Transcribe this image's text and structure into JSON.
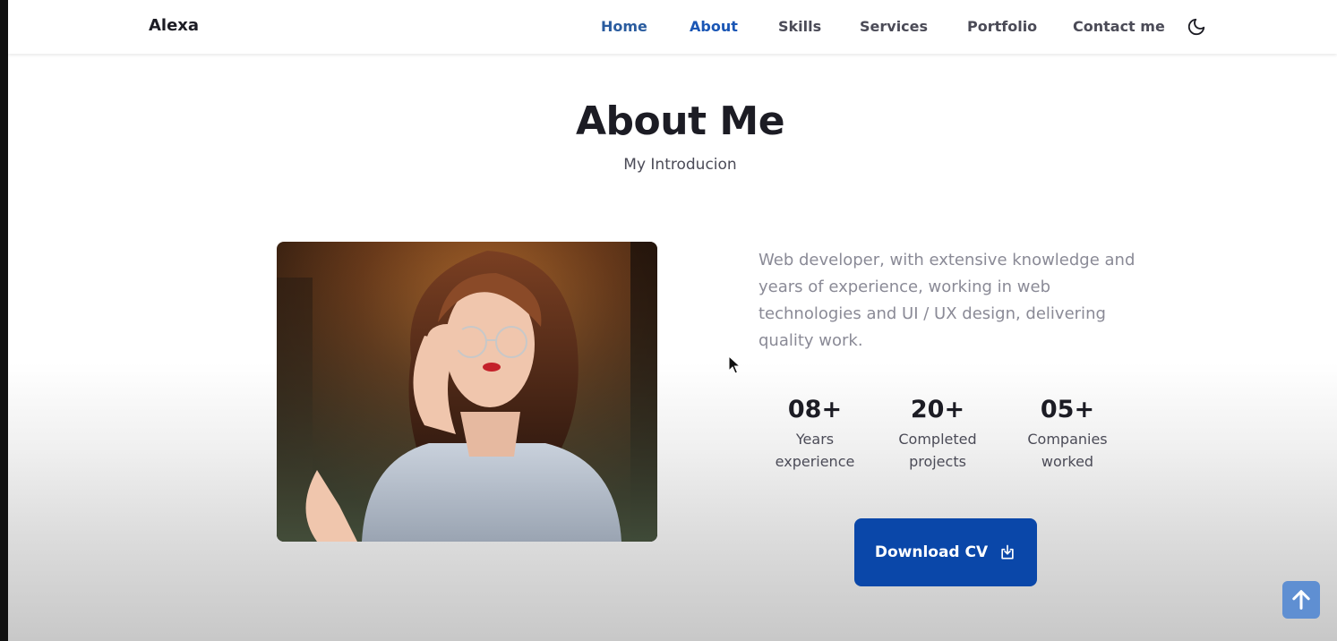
{
  "header": {
    "logo": "Alexa",
    "nav": [
      {
        "label": "Home"
      },
      {
        "label": "About"
      },
      {
        "label": "Skills"
      },
      {
        "label": "Services"
      },
      {
        "label": "Portfolio"
      },
      {
        "label": "Contact me"
      }
    ],
    "active_nav": "About",
    "theme_icon": "moon-icon"
  },
  "about": {
    "title": "About Me",
    "subtitle": "My Introducion",
    "description": "Web developer, with extensive knowledge and years of experience, working in web technologies and UI / UX design, delivering quality work.",
    "stats": [
      {
        "number": "08+",
        "label_line1": "Years",
        "label_line2": "experience"
      },
      {
        "number": "20+",
        "label_line1": "Completed",
        "label_line2": "projects"
      },
      {
        "number": "05+",
        "label_line1": "Companies",
        "label_line2": "worked"
      }
    ],
    "download_label": "Download CV",
    "download_icon": "download-icon"
  },
  "scroll_top_icon": "arrow-up-icon",
  "colors": {
    "accent": "#0a47a9",
    "active_nav": "#1a56b5",
    "scroll_button": "#5f8fd2"
  }
}
